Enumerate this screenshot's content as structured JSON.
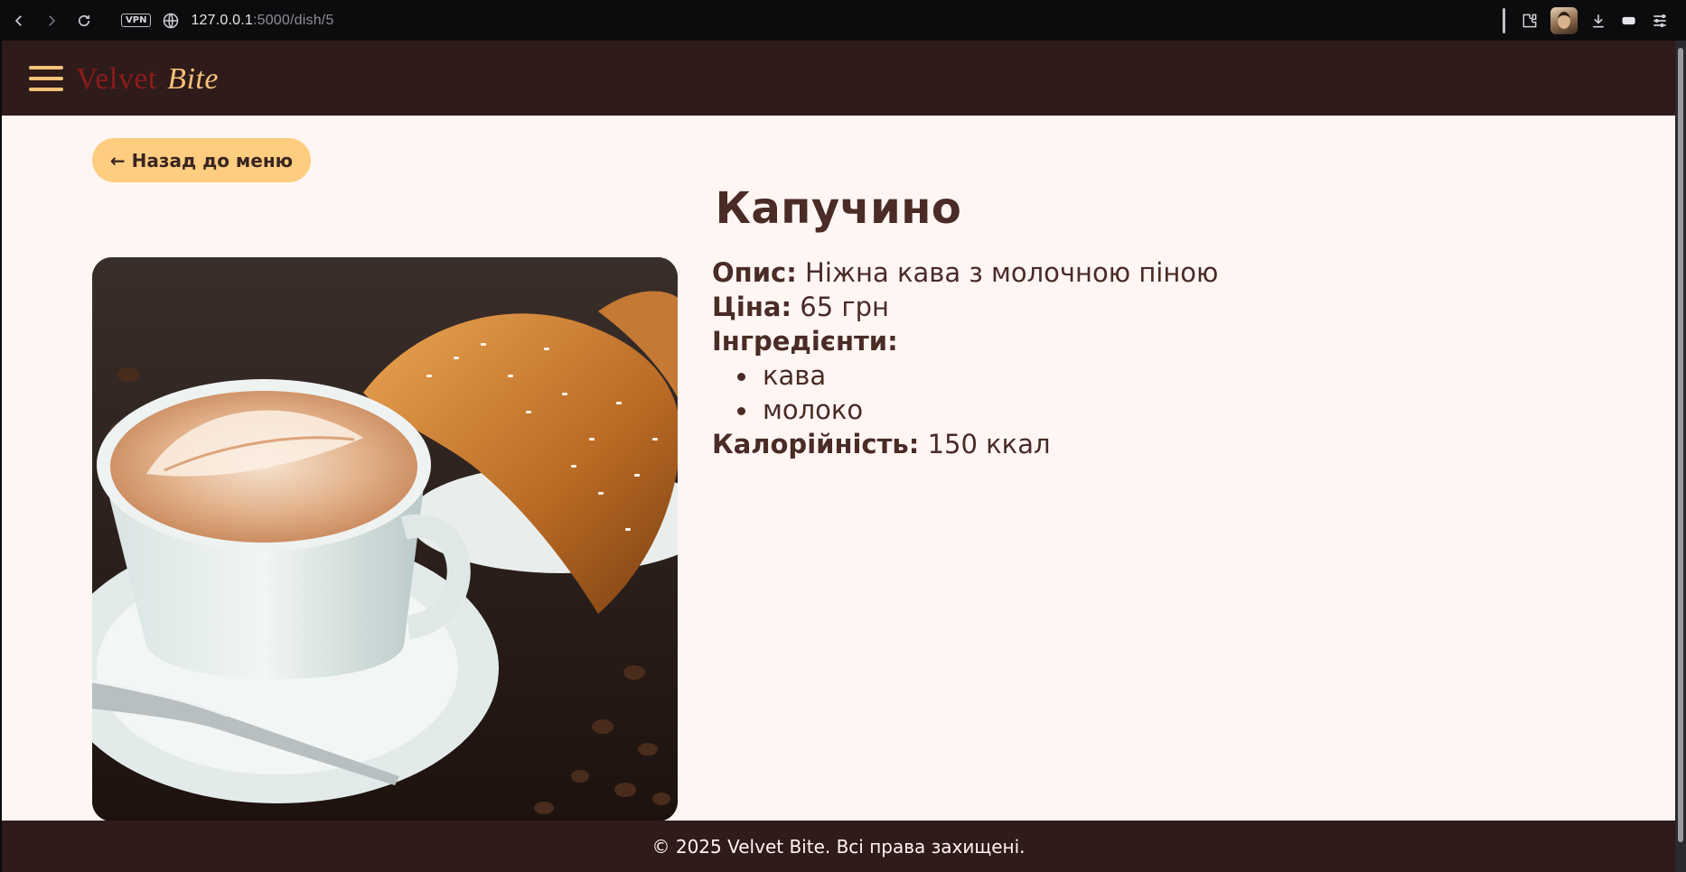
{
  "browser": {
    "url_host": "127.0.0.1",
    "url_rest": ":5000/dish/5",
    "vpn_label": "VPN"
  },
  "header": {
    "logo_part1": "Velvet",
    "logo_part2": "Bite"
  },
  "page": {
    "back_label": "← Назад до меню",
    "dish_title": "Капучино"
  },
  "details": {
    "description_label": "Опис:",
    "description_value": "Ніжна кава з молочною піною",
    "price_label": "Ціна:",
    "price_value": "65 грн",
    "ingredients_label": "Інгредієнти:",
    "ingredients": [
      "кава",
      "молоко"
    ],
    "calories_label": "Калорійність:",
    "calories_value": "150 ккал"
  },
  "footer": {
    "text": "© 2025 Velvet Bite. Всі права захищені."
  },
  "colors": {
    "header_bg": "#2f1b1a",
    "page_bg": "#fff6f3",
    "accent": "#ffcd80",
    "text_dark": "#4a2b26",
    "logo_red": "#8b1c1c"
  }
}
